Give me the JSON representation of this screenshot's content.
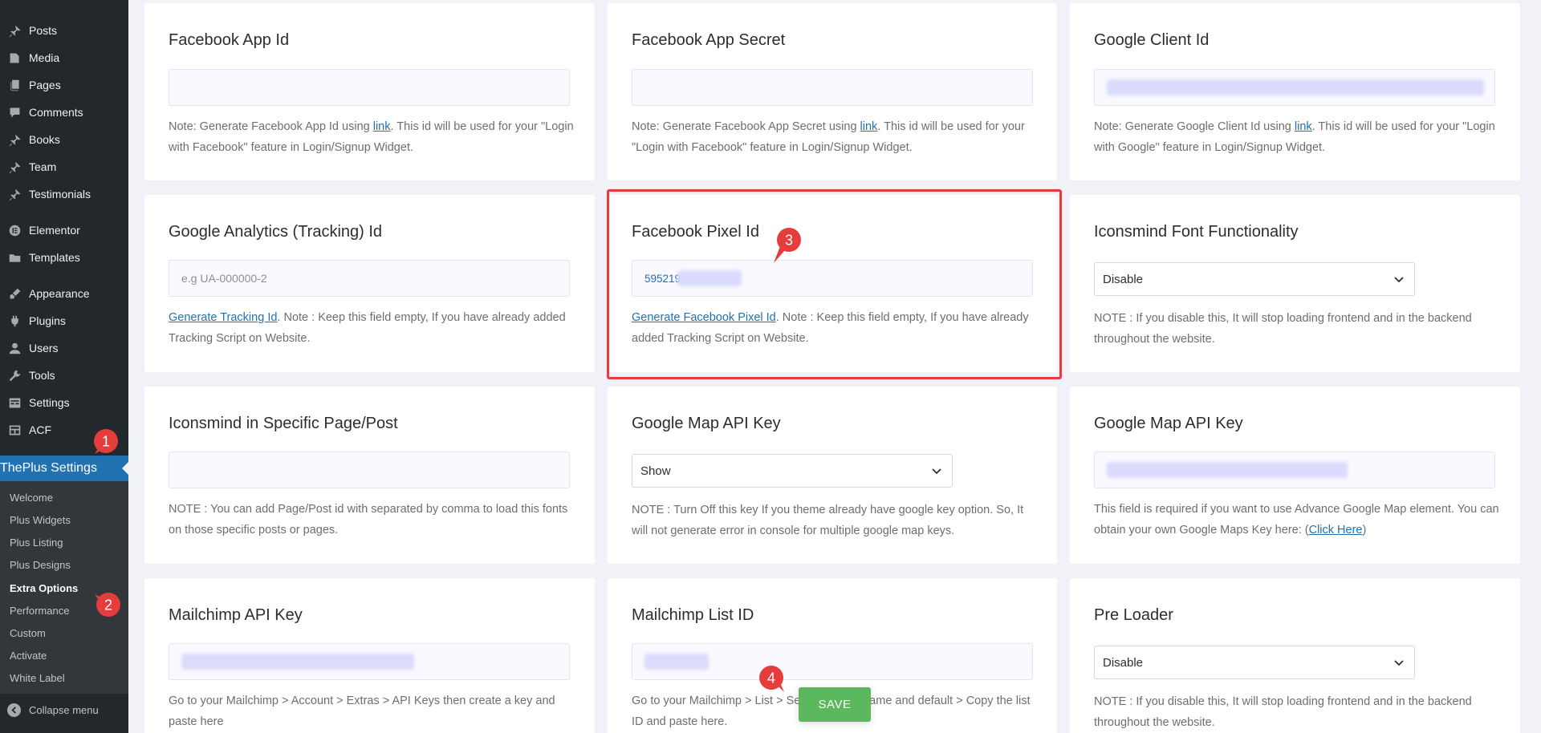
{
  "sidebar": {
    "items": [
      {
        "label": "Posts",
        "icon": "pin-icon"
      },
      {
        "label": "Media",
        "icon": "media-icon"
      },
      {
        "label": "Pages",
        "icon": "pages-icon"
      },
      {
        "label": "Comments",
        "icon": "comments-icon"
      },
      {
        "label": "Books",
        "icon": "pin-icon"
      },
      {
        "label": "Team",
        "icon": "pin-icon"
      },
      {
        "label": "Testimonials",
        "icon": "pin-icon"
      },
      {
        "label": "Elementor",
        "icon": "elementor-icon"
      },
      {
        "label": "Templates",
        "icon": "folder-icon"
      },
      {
        "label": "Appearance",
        "icon": "brush-icon"
      },
      {
        "label": "Plugins",
        "icon": "plugin-icon"
      },
      {
        "label": "Users",
        "icon": "user-icon"
      },
      {
        "label": "Tools",
        "icon": "wrench-icon"
      },
      {
        "label": "Settings",
        "icon": "settings-icon"
      },
      {
        "label": "ACF",
        "icon": "acf-icon"
      }
    ],
    "active_item": {
      "label": "ThePlus Settings",
      "icon": "theplus-icon"
    },
    "submenu": [
      "Welcome",
      "Plus Widgets",
      "Plus Listing",
      "Plus Designs",
      "Extra Options",
      "Performance",
      "Custom",
      "Activate",
      "White Label"
    ],
    "submenu_current": "Extra Options",
    "collapse_label": "Collapse menu"
  },
  "cards": {
    "fb_app_id": {
      "title": "Facebook App Id",
      "note_before": "Note: Generate Facebook App Id using ",
      "link": "link",
      "note_after": ". This id will be used for your \"Login with Facebook\" feature in Login/Signup Widget."
    },
    "fb_app_secret": {
      "title": "Facebook App Secret",
      "note_before": "Note: Generate Facebook App Secret using ",
      "link": "link",
      "note_after": ". This id will be used for your \"Login with Facebook\" feature in Login/Signup Widget."
    },
    "google_client_id": {
      "title": "Google Client Id",
      "note_before": "Note: Generate Google Client Id using ",
      "link": "link",
      "note_after": ". This id will be used for your \"Login with Google\" feature in Login/Signup Widget."
    },
    "google_analytics": {
      "title": "Google Analytics (Tracking) Id",
      "placeholder": "e.g UA-000000-2",
      "link": "Generate Tracking Id",
      "note_after": ". Note : Keep this field empty, If you have already added Tracking Script on Website."
    },
    "fb_pixel": {
      "title": "Facebook Pixel Id",
      "value": "595219",
      "link": "Generate Facebook Pixel Id",
      "note_after": ". Note : Keep this field empty, If you have already added Tracking Script on Website."
    },
    "iconsmind_font": {
      "title": "Iconsmind Font Functionality",
      "selected": "Disable",
      "note": "NOTE : If you disable this, It will stop loading frontend and in the backend throughout the website."
    },
    "iconsmind_specific": {
      "title": "Iconsmind in Specific Page/Post",
      "note": "NOTE : You can add Page/Post id with separated by comma to load this fonts on those specific posts or pages."
    },
    "google_map_toggle": {
      "title": "Google Map API Key",
      "selected": "Show",
      "note": "NOTE : Turn Off this key If you theme already have google key option. So, It will not generate error in console for multiple google map keys."
    },
    "google_map_key": {
      "title": "Google Map API Key",
      "note_before": "This field is required if you want to use Advance Google Map element. You can obtain your own Google Maps Key here: (",
      "link": "Click Here",
      "note_after": ")"
    },
    "mailchimp_api": {
      "title": "Mailchimp API Key",
      "note": "Go to your Mailchimp > Account > Extras > API Keys then create a key and paste here"
    },
    "mailchimp_list": {
      "title": "Mailchimp List ID",
      "note": "Go to your Mailchimp > List > Settings > List name and default > Copy the list ID and paste here."
    },
    "pre_loader": {
      "title": "Pre Loader",
      "selected": "Disable",
      "note": "NOTE : If you disable this, It will stop loading frontend and in the backend throughout the website."
    }
  },
  "badges": [
    "1",
    "2",
    "3",
    "4"
  ],
  "save_label": "SAVE",
  "colors": {
    "accent": "#2271b1",
    "highlight": "#e53c3c",
    "badge": "#e53c3c",
    "save": "#5cb85c",
    "sidebar": "#23282d"
  }
}
